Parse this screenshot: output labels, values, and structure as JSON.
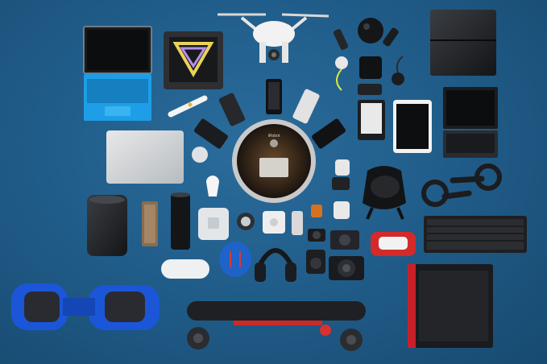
{
  "scene": {
    "background_color": "#1f5a86",
    "accent_colors": {
      "laptop_blue": "#1e9ee6",
      "hoverboard_blue": "#1b56d8",
      "speaker_blue": "#1f62c8",
      "headset_red": "#d42a2a",
      "pc_red": "#c8202a"
    },
    "labels": {
      "roomba_brand": "iRobot"
    },
    "objects": [
      "surface-laptop-icon",
      "pixel-display-icon",
      "drone-icon",
      "vr-sensor-icon",
      "game-console-icon",
      "smartwatch-icon",
      "smartphone-icon",
      "ereader-icon",
      "tablet-icon",
      "keyboard-tablet-icon",
      "macbook-icon",
      "robot-vacuum-icon",
      "vr-headset-icon",
      "vr-controller-icon",
      "mac-pro-icon",
      "speaker-icon",
      "smart-home-hub-icon",
      "headphones-icon",
      "camera-icon",
      "mechanical-keyboard-icon",
      "hoverboard-icon",
      "electric-skateboard-icon",
      "gaming-pc-icon"
    ]
  }
}
